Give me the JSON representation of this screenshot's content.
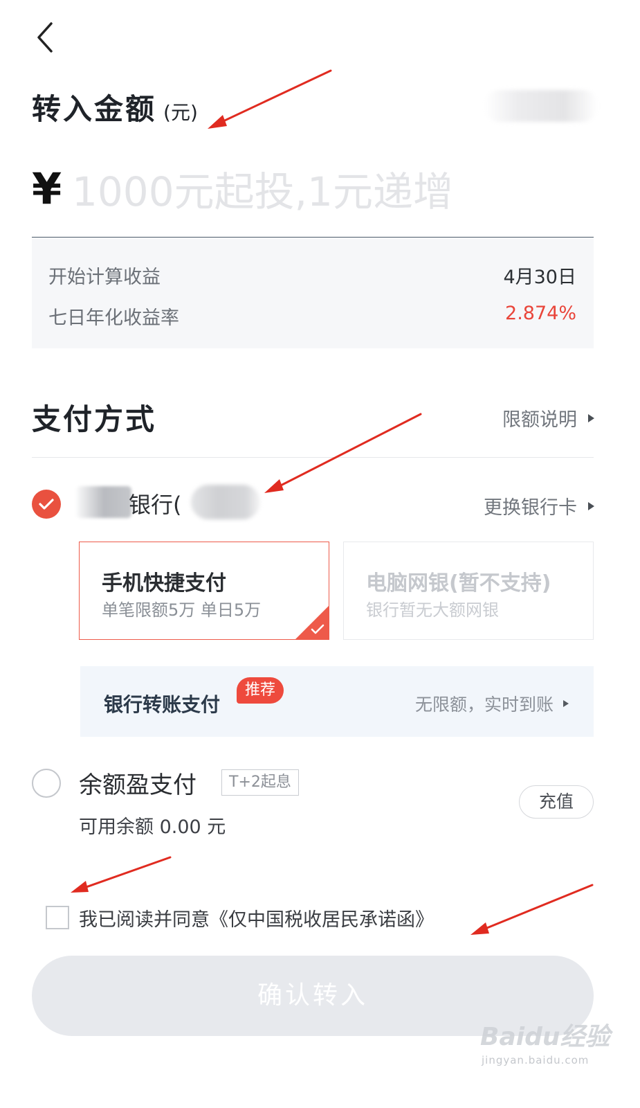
{
  "header": {
    "back_icon": "chevron-left-icon"
  },
  "amount": {
    "title": "转入金额",
    "unit": "(元)",
    "currency": "¥",
    "placeholder": "1000元起投,1元递增"
  },
  "info": {
    "start_label": "开始计算收益",
    "start_value": "4月30日",
    "rate_label": "七日年化收益率",
    "rate_value": "2.874%",
    "rate_color": "#e9453a"
  },
  "payment": {
    "title": "支付方式",
    "limit_link": "限额说明",
    "bank": {
      "name": "银行(",
      "change_link": "更换银行卡"
    },
    "options": [
      {
        "title": "手机快捷支付",
        "sub": "单笔限额5万 单日5万"
      },
      {
        "title": "电脑网银(暂不支持)",
        "sub": "银行暂无大额网银"
      }
    ],
    "transfer": {
      "label": "银行转账支付",
      "tag": "推荐",
      "desc": "无限额，实时到账"
    },
    "balance": {
      "title": "余额盈支付",
      "tag": "T+2起息",
      "sub": "可用余额 0.00 元",
      "recharge": "充值"
    }
  },
  "agreement": {
    "text": "我已阅读并同意《仅中国税收居民承诺函》"
  },
  "confirm": {
    "label": "确认转入"
  },
  "watermark": {
    "brand": "Baidu经验",
    "url": "jingyan.baidu.com"
  },
  "colors": {
    "accent": "#e9513f",
    "annotation_arrow": "#e02b20"
  }
}
